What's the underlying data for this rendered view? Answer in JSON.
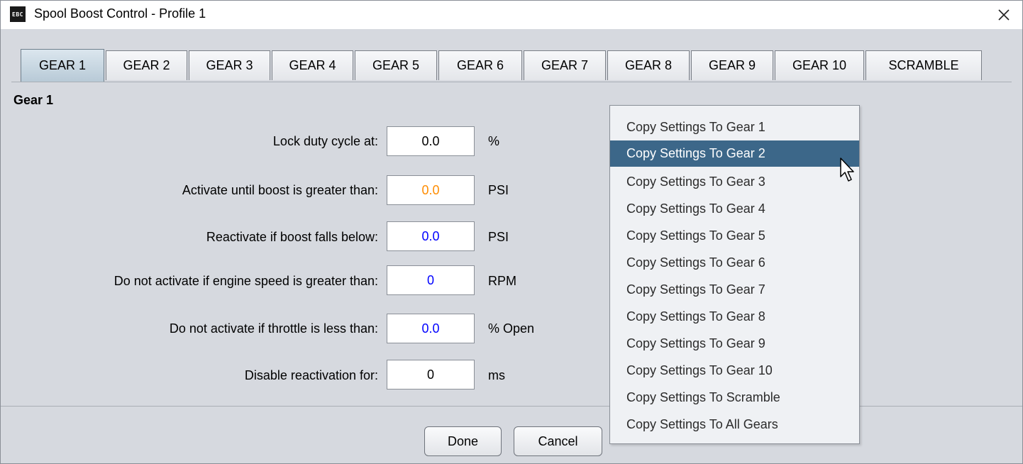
{
  "window": {
    "title": "Spool Boost Control - Profile 1",
    "app_icon_text": "EBC"
  },
  "tabs": [
    {
      "label": "GEAR 1",
      "active": true
    },
    {
      "label": "GEAR 2"
    },
    {
      "label": "GEAR 3"
    },
    {
      "label": "GEAR 4"
    },
    {
      "label": "GEAR 5"
    },
    {
      "label": "GEAR 6"
    },
    {
      "label": "GEAR 7"
    },
    {
      "label": "GEAR 8"
    },
    {
      "label": "GEAR 9"
    },
    {
      "label": "GEAR 10"
    },
    {
      "label": "SCRAMBLE"
    }
  ],
  "section": {
    "title": "Gear 1"
  },
  "settings": [
    {
      "label": "Lock duty cycle at:",
      "value": "0.0",
      "unit": "%",
      "value_color": "#000000"
    },
    {
      "label": "Activate until boost is greater than:",
      "value": "0.0",
      "unit": "PSI",
      "value_color": "#ff8c00"
    },
    {
      "label": "Reactivate if boost falls below:",
      "value": "0.0",
      "unit": "PSI",
      "value_color": "#0000ff"
    },
    {
      "label": "Do not activate if engine speed is greater than:",
      "value": "0",
      "unit": "RPM",
      "value_color": "#0000ff"
    },
    {
      "label": "Do not activate if throttle is less than:",
      "value": "0.0",
      "unit": "% Open",
      "value_color": "#0000ff"
    },
    {
      "label": "Disable reactivation for:",
      "value": "0",
      "unit": "ms",
      "value_color": "#000000"
    }
  ],
  "buttons": {
    "done": "Done",
    "cancel": "Cancel"
  },
  "context_menu": {
    "items": [
      {
        "label": "Copy Settings To Gear 1"
      },
      {
        "label": "Copy Settings To Gear 2",
        "selected": true
      },
      {
        "label": "Copy Settings To Gear 3"
      },
      {
        "label": "Copy Settings To Gear 4"
      },
      {
        "label": "Copy Settings To Gear 5"
      },
      {
        "label": "Copy Settings To Gear 6"
      },
      {
        "label": "Copy Settings To Gear 7"
      },
      {
        "label": "Copy Settings To Gear 8"
      },
      {
        "label": "Copy Settings To Gear 9"
      },
      {
        "label": "Copy Settings To Gear 10"
      },
      {
        "label": "Copy Settings To Scramble"
      },
      {
        "label": "Copy Settings To All Gears"
      }
    ]
  },
  "colors": {
    "menu_highlight": "#3c6789",
    "active_tab": "#b8cad7"
  },
  "icons": {
    "close": "close-icon",
    "cursor": "mouse-pointer-icon"
  }
}
